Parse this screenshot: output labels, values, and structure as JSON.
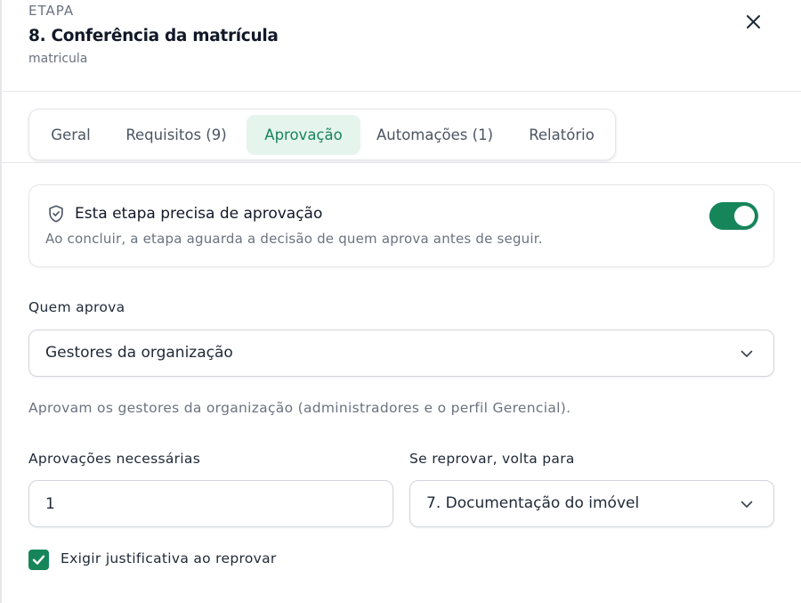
{
  "colors": {
    "accent": "#16855a",
    "accent_soft": "#e6f4ee",
    "border": "#e5e7eb",
    "muted_text": "#6b7280"
  },
  "header": {
    "eyebrow": "ETAPA",
    "title": "8. Conferência da matrícula",
    "subtitle": "matricula",
    "close_icon": "close-icon"
  },
  "tabs": [
    {
      "label": "Geral",
      "active": false
    },
    {
      "label": "Requisitos (9)",
      "active": false
    },
    {
      "label": "Aprovação",
      "active": true
    },
    {
      "label": "Automações (1)",
      "active": false
    },
    {
      "label": "Relatório",
      "active": false
    }
  ],
  "approval_card": {
    "icon": "shield-check-icon",
    "title": "Esta etapa precisa de aprovação",
    "description": "Ao concluir, a etapa aguarda a decisão de quem aprova antes de seguir.",
    "toggle_on": true
  },
  "approver": {
    "label": "Quem aprova",
    "selected": "Gestores da organização",
    "hint": "Aprovam os gestores da organização (administradores e o perfil Gerencial)."
  },
  "required_approvals": {
    "label": "Aprovações necessárias",
    "value": "1"
  },
  "reject_return": {
    "label": "Se reprovar, volta para",
    "selected": "7. Documentação do imóvel"
  },
  "require_justification": {
    "label": "Exigir justificativa ao reprovar",
    "checked": true
  }
}
